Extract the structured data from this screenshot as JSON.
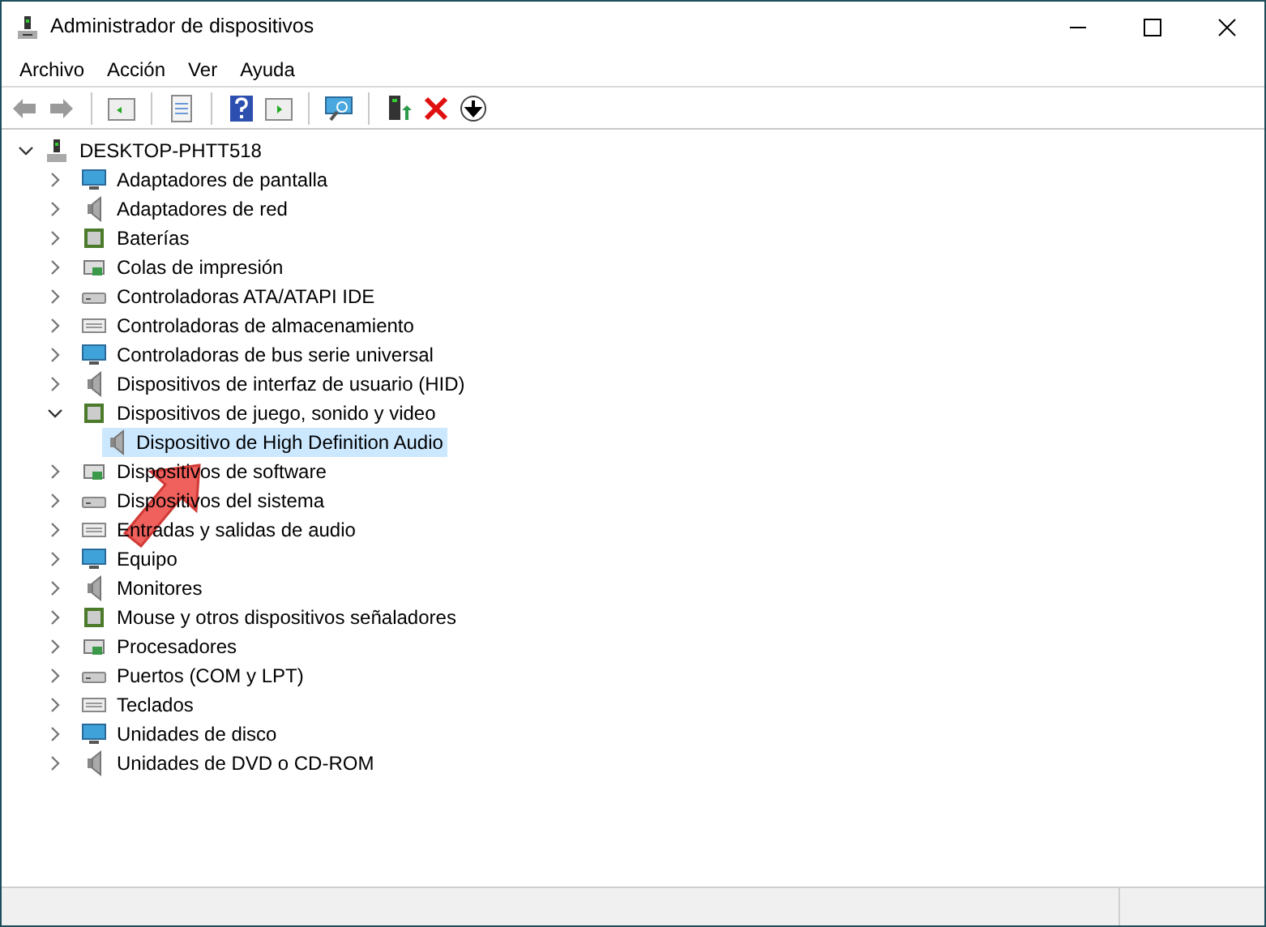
{
  "window": {
    "title": "Administrador de dispositivos"
  },
  "menu": [
    "Archivo",
    "Acción",
    "Ver",
    "Ayuda"
  ],
  "tree": {
    "label": "DESKTOP-PHTT518",
    "expanded": true,
    "children": [
      {
        "label": "Adaptadores de pantalla",
        "expanded": false
      },
      {
        "label": "Adaptadores de red",
        "expanded": false
      },
      {
        "label": "Baterías",
        "expanded": false
      },
      {
        "label": "Colas de impresión",
        "expanded": false
      },
      {
        "label": "Controladoras ATA/ATAPI IDE",
        "expanded": false
      },
      {
        "label": "Controladoras de almacenamiento",
        "expanded": false
      },
      {
        "label": "Controladoras de bus serie universal",
        "expanded": false
      },
      {
        "label": "Dispositivos de interfaz de usuario (HID)",
        "expanded": false
      },
      {
        "label": "Dispositivos de juego, sonido y video",
        "expanded": true,
        "children": [
          {
            "label": "Dispositivo de High Definition Audio",
            "selected": true
          }
        ]
      },
      {
        "label": "Dispositivos de software",
        "expanded": false
      },
      {
        "label": "Dispositivos del sistema",
        "expanded": false
      },
      {
        "label": "Entradas y salidas de audio",
        "expanded": false
      },
      {
        "label": "Equipo",
        "expanded": false
      },
      {
        "label": "Monitores",
        "expanded": false
      },
      {
        "label": "Mouse y otros dispositivos señaladores",
        "expanded": false
      },
      {
        "label": "Procesadores",
        "expanded": false
      },
      {
        "label": "Puertos (COM y LPT)",
        "expanded": false
      },
      {
        "label": "Teclados",
        "expanded": false
      },
      {
        "label": "Unidades de disco",
        "expanded": false
      },
      {
        "label": "Unidades de DVD o CD-ROM",
        "expanded": false
      }
    ]
  }
}
